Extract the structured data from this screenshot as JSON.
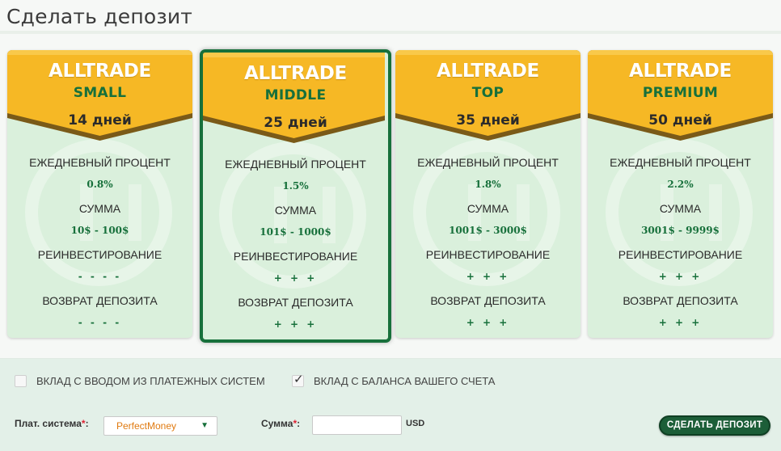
{
  "page": {
    "title": "Сделать депозит"
  },
  "plans": [
    {
      "brand": "ALLTRADE",
      "name": "SMALL",
      "duration": "14 дней",
      "daily_label": "ЕЖЕДНЕВНЫЙ ПРОЦЕНТ",
      "daily_value": "0.8%",
      "sum_label": "СУММА",
      "sum_value": "10$ - 100$",
      "reinvest_label": "РЕИНВЕСТИРОВАНИЕ",
      "reinvest_value": "- - - -",
      "return_label": "ВОЗВРАТ ДЕПОЗИТА",
      "return_value": "- - - -",
      "selected": false
    },
    {
      "brand": "ALLTRADE",
      "name": "MIDDLE",
      "duration": "25 дней",
      "daily_label": "ЕЖЕДНЕВНЫЙ ПРОЦЕНТ",
      "daily_value": "1.5%",
      "sum_label": "СУММА",
      "sum_value": "101$ - 1000$",
      "reinvest_label": "РЕИНВЕСТИРОВАНИЕ",
      "reinvest_value": "+ + +",
      "return_label": "ВОЗВРАТ ДЕПОЗИТА",
      "return_value": "+ + +",
      "selected": true
    },
    {
      "brand": "ALLTRADE",
      "name": "TOP",
      "duration": "35 дней",
      "daily_label": "ЕЖЕДНЕВНЫЙ ПРОЦЕНТ",
      "daily_value": "1.8%",
      "sum_label": "СУММА",
      "sum_value": "1001$ - 3000$",
      "reinvest_label": "РЕИНВЕСТИРОВАНИЕ",
      "reinvest_value": "+ + +",
      "return_label": "ВОЗВРАТ ДЕПОЗИТА",
      "return_value": "+ + +",
      "selected": false
    },
    {
      "brand": "ALLTRADE",
      "name": "PREMIUM",
      "duration": "50 дней",
      "daily_label": "ЕЖЕДНЕВНЫЙ ПРОЦЕНТ",
      "daily_value": "2.2%",
      "sum_label": "СУММА",
      "sum_value": "3001$ - 9999$",
      "reinvest_label": "РЕИНВЕСТИРОВАНИЕ",
      "reinvest_value": "+ + +",
      "return_label": "ВОЗВРАТ ДЕПОЗИТА",
      "return_value": "+ + +",
      "selected": false
    }
  ],
  "form": {
    "option_payment_systems": {
      "label": "ВКЛАД С ВВОДОМ ИЗ ПЛАТЕЖНЫХ СИСТЕМ",
      "checked": false
    },
    "option_balance": {
      "label": "ВКЛАД С БАЛАНСА ВАШЕГО СЧЕТА",
      "checked": true
    },
    "payment_system_label": "Плат. система",
    "payment_system_value": "PerfectMoney",
    "amount_label": "Сумма",
    "required_mark": "*",
    "label_colon": ":",
    "amount_value": "",
    "currency": "USD",
    "submit_label": "СДЕЛАТЬ ДЕПОЗИТ"
  },
  "colors": {
    "accent_green": "#17703b",
    "header_orange": "#f6b825",
    "card_bg": "#daf0dc"
  }
}
